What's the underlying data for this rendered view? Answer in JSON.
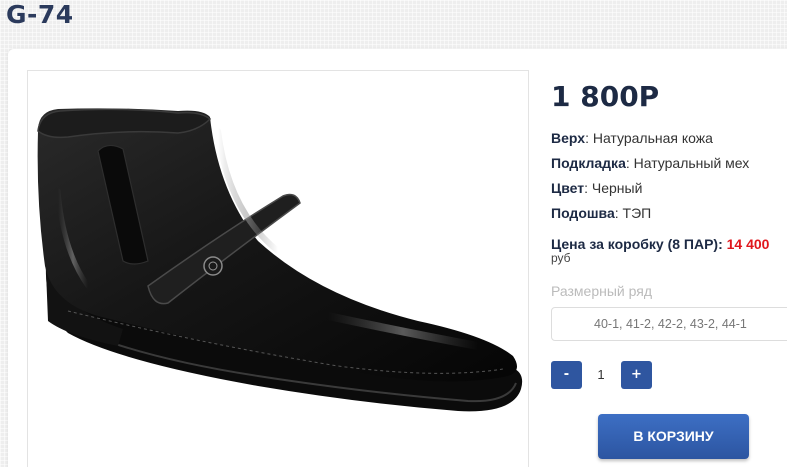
{
  "product": {
    "title": "G-74",
    "price": "1 800Р",
    "specs": [
      {
        "label": "Верх",
        "value": "Натуральная кожа"
      },
      {
        "label": "Подкладка",
        "value": "Натуральный мех"
      },
      {
        "label": "Цвет",
        "value": "Черный"
      },
      {
        "label": "Подошва",
        "value": "ТЭП"
      }
    ],
    "box_price_label": "Цена за коробку (8 ПАР):",
    "box_price_value": "14 400",
    "box_price_unit": "руб",
    "size_label": "Размерный ряд",
    "size_value": "40-1, 41-2, 42-2, 43-2, 44-1",
    "image_icon": "black-leather-ankle-boot"
  },
  "quantity": {
    "minus_label": "-",
    "value": "1",
    "plus_label": "+"
  },
  "cart_button_label": "В КОРЗИНУ",
  "colors": {
    "accent": "#2f56a0",
    "price_highlight": "#e0161c",
    "title": "#2b3a5c"
  }
}
